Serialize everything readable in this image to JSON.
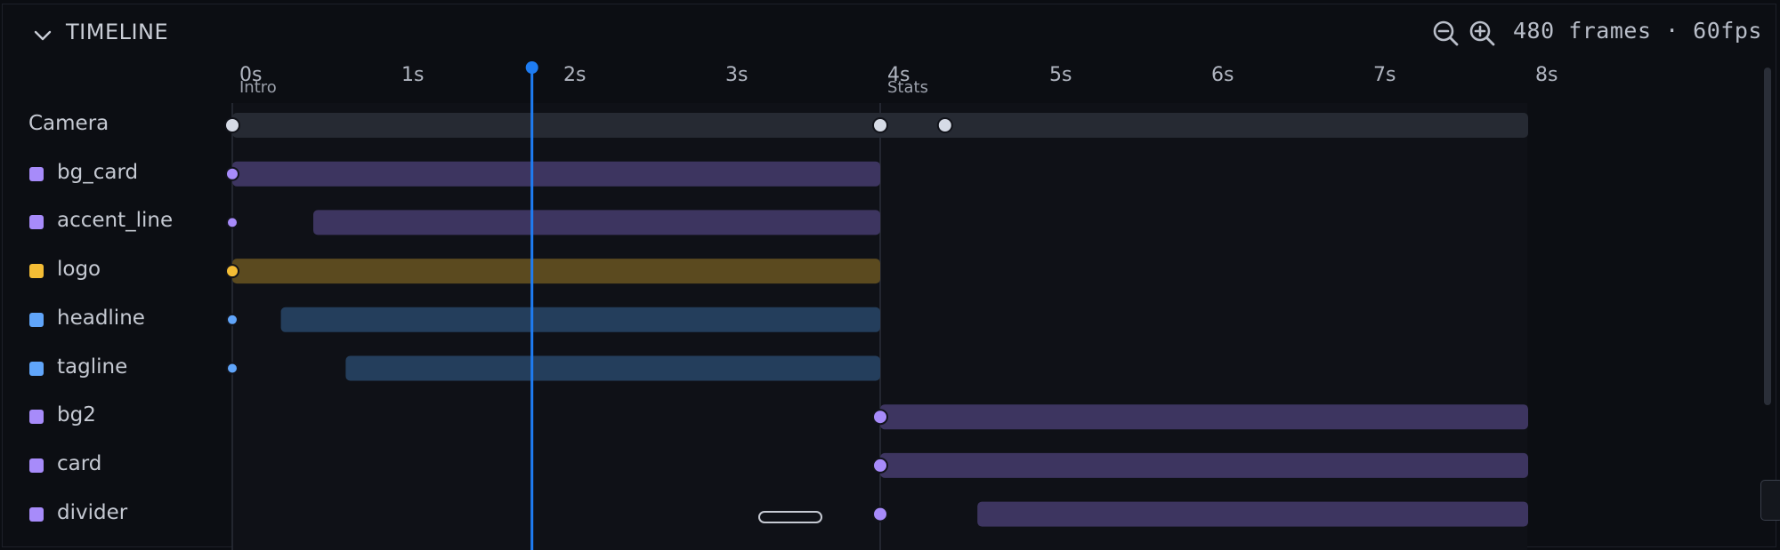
{
  "panel": {
    "title": "TIMELINE",
    "frames_info": "480 frames · 60fps",
    "zoom_out_icon": "zoom-out-icon",
    "zoom_in_icon": "zoom-in-icon",
    "collapse_icon": "chevron-down-icon"
  },
  "ruler": {
    "ticks": [
      "0s",
      "1s",
      "2s",
      "3s",
      "4s",
      "5s",
      "6s",
      "7s",
      "8s"
    ],
    "markers": [
      {
        "label": "Intro",
        "time": 0
      },
      {
        "label": "Stats",
        "time": 4
      }
    ]
  },
  "playhead": {
    "time": 1.85,
    "color": "#1e7cf2"
  },
  "tracks": [
    {
      "name": "Camera",
      "swatch": null,
      "bar_color": "#262a33",
      "kf_color": "#d6dbe6",
      "bar": [
        0,
        8
      ],
      "keyframes": [
        0,
        4,
        4.4
      ]
    },
    {
      "name": "bg_card",
      "swatch": "#a78bfa",
      "bar_color": "#3d3560",
      "kf_color": "#a78bfa",
      "bar": [
        0,
        4
      ],
      "keyframes": [
        0
      ]
    },
    {
      "name": "accent_line",
      "swatch": "#a78bfa",
      "bar_color": "#3d3560",
      "kf_color": "#a78bfa",
      "bar": [
        0.5,
        4
      ],
      "keyframes": [
        0
      ]
    },
    {
      "name": "logo",
      "swatch": "#f4bd35",
      "bar_color": "#5b4a1f",
      "kf_color": "#f4bd35",
      "bar": [
        0,
        4
      ],
      "keyframes": [
        0
      ]
    },
    {
      "name": "headline",
      "swatch": "#60a5fa",
      "bar_color": "#243e5c",
      "kf_color": "#60a5fa",
      "bar": [
        0.3,
        4
      ],
      "keyframes": [
        0
      ]
    },
    {
      "name": "tagline",
      "swatch": "#60a5fa",
      "bar_color": "#243e5c",
      "kf_color": "#60a5fa",
      "bar": [
        0.7,
        4
      ],
      "keyframes": [
        0
      ]
    },
    {
      "name": "bg2",
      "swatch": "#a78bfa",
      "bar_color": "#3d3560",
      "kf_color": "#a78bfa",
      "bar": [
        4,
        8
      ],
      "keyframes": [
        4
      ]
    },
    {
      "name": "card",
      "swatch": "#a78bfa",
      "bar_color": "#3d3560",
      "kf_color": "#a78bfa",
      "bar": [
        4,
        8
      ],
      "keyframes": [
        4
      ]
    },
    {
      "name": "divider",
      "swatch": "#a78bfa",
      "bar_color": "#3d3560",
      "kf_color": "#a78bfa",
      "bar": [
        4.6,
        8
      ],
      "keyframes": [
        4
      ]
    }
  ]
}
